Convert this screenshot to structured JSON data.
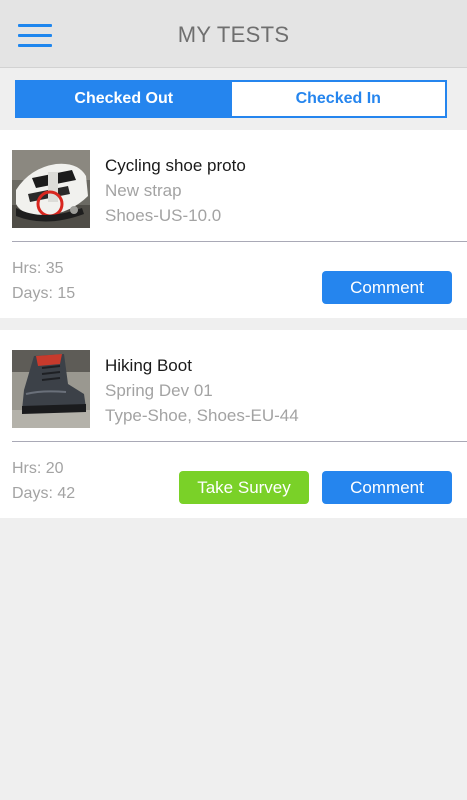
{
  "header": {
    "title": "MY TESTS",
    "menu_icon": "hamburger-menu-icon"
  },
  "tabs": [
    {
      "label": "Checked Out",
      "active": true
    },
    {
      "label": "Checked In",
      "active": false
    }
  ],
  "tests": [
    {
      "title": "Cycling shoe proto",
      "subtitle": "New strap",
      "spec": "Shoes-US-10.0",
      "hrs": "Hrs: 35",
      "days": "Days: 15",
      "comment_label": "Comment",
      "image": "cycling-shoe-photo"
    },
    {
      "title": "Hiking Boot",
      "subtitle": "Spring Dev 01",
      "spec": "Type-Shoe, Shoes-EU-44",
      "hrs": "Hrs: 20",
      "days": "Days: 42",
      "survey_label": "Take Survey",
      "comment_label": "Comment",
      "image": "hiking-boot-photo"
    }
  ],
  "colors": {
    "accent": "#2585ee",
    "survey": "#7ad128",
    "header_bg": "#e4e4e4",
    "page_bg": "#efefef"
  }
}
